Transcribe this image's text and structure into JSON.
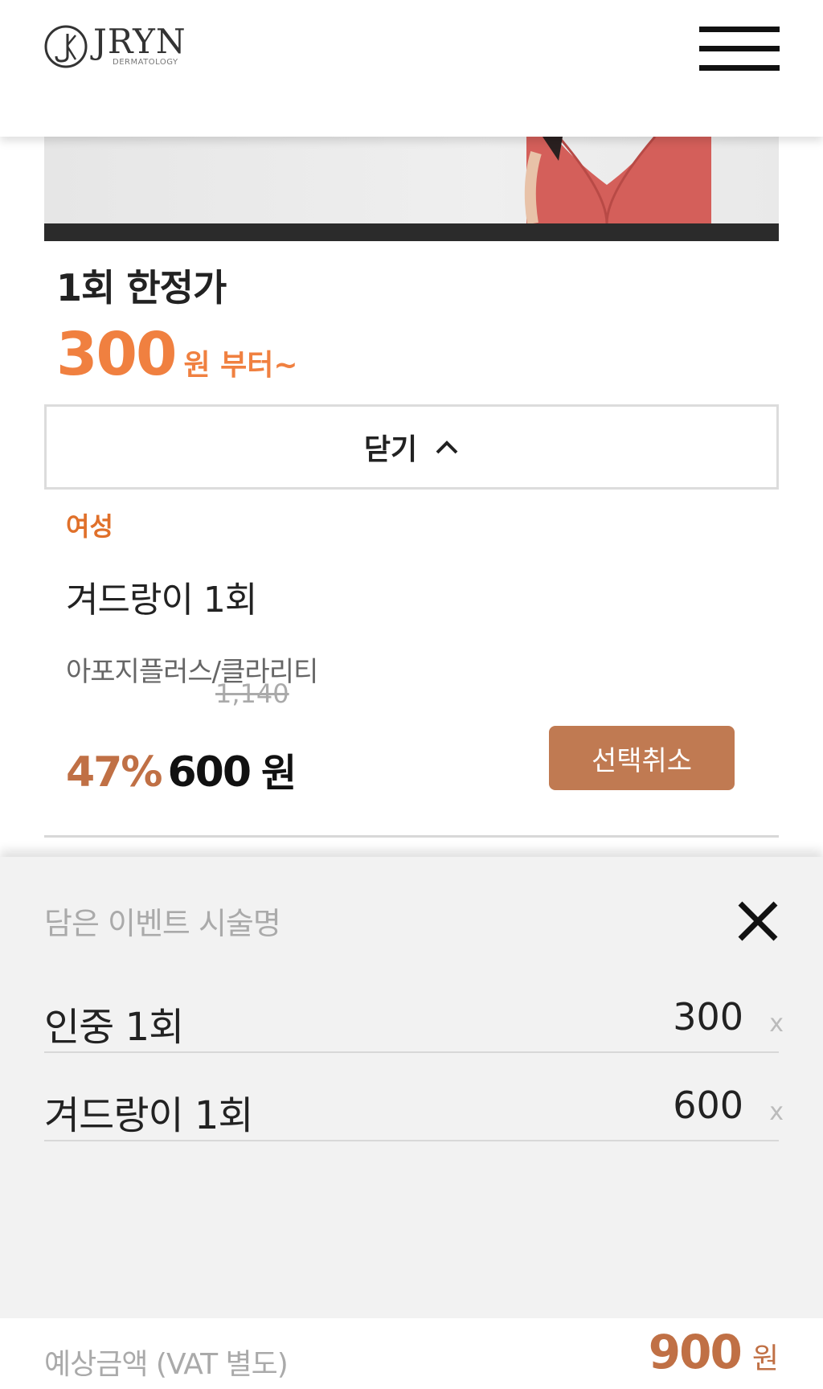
{
  "header": {
    "logo_name": "JRYN",
    "logo_sub": "DERMATOLOGY"
  },
  "promo": {
    "title": "1회 한정가",
    "price": "300",
    "price_suffix": "원 부터~"
  },
  "toggle": {
    "label": "닫기"
  },
  "item": {
    "gender": "여성",
    "name": "겨드랑이 1회",
    "description": "아포지플러스/클라리티",
    "original_price": "1,140",
    "discount": "47%",
    "sale_price": "600",
    "currency": "원",
    "deselect_label": "선택취소"
  },
  "cart": {
    "title": "담은 이벤트 시술명",
    "close_label": "X",
    "items": [
      {
        "name": "인중 1회",
        "price": "300",
        "remove": "x"
      },
      {
        "name": "겨드랑이 1회",
        "price": "600",
        "remove": "x"
      }
    ]
  },
  "total": {
    "label": "예상금액 (VAT 별도)",
    "amount": "900",
    "currency": "원"
  },
  "colors": {
    "accent_orange": "#f08040",
    "accent_brown": "#c07045",
    "button_brown": "#c07a52"
  }
}
